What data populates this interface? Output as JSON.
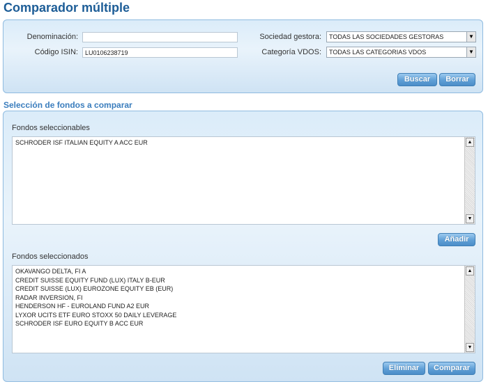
{
  "page": {
    "title": "Comparador múltiple"
  },
  "search": {
    "denominacion_label": "Denominación:",
    "denominacion_value": "",
    "isin_label": "Código ISIN:",
    "isin_value": "LU0106238719",
    "gestora_label": "Sociedad gestora:",
    "gestora_value": "TODAS LAS SOCIEDADES GESTORAS",
    "categoria_label": "Categoría VDOS:",
    "categoria_value": "TODAS LAS CATEGORIAS VDOS",
    "buscar_label": "Buscar",
    "borrar_label": "Borrar"
  },
  "selection": {
    "section_title": "Selección de fondos a comparar",
    "selectable_label": "Fondos seleccionables",
    "selectable_items": [
      "SCHRODER ISF ITALIAN EQUITY A ACC EUR"
    ],
    "add_label": "Añadir",
    "selected_label": "Fondos seleccionados",
    "selected_items": [
      "OKAVANGO DELTA, FI A",
      "CREDIT SUISSE EQUITY FUND (LUX) ITALY B-EUR",
      "CREDIT SUISSE (LUX) EUROZONE EQUITY EB (EUR)",
      "RADAR INVERSION, FI",
      "HENDERSON HF - EUROLAND FUND A2 EUR",
      "LYXOR UCITS ETF EURO STOXX 50 DAILY LEVERAGE",
      "SCHRODER ISF EURO EQUITY B ACC EUR"
    ],
    "eliminar_label": "Eliminar",
    "comparar_label": "Comparar"
  },
  "icons": {
    "dropdown": "chevron-down-icon",
    "scroll_up": "arrow-up-icon",
    "scroll_down": "arrow-down-icon"
  }
}
